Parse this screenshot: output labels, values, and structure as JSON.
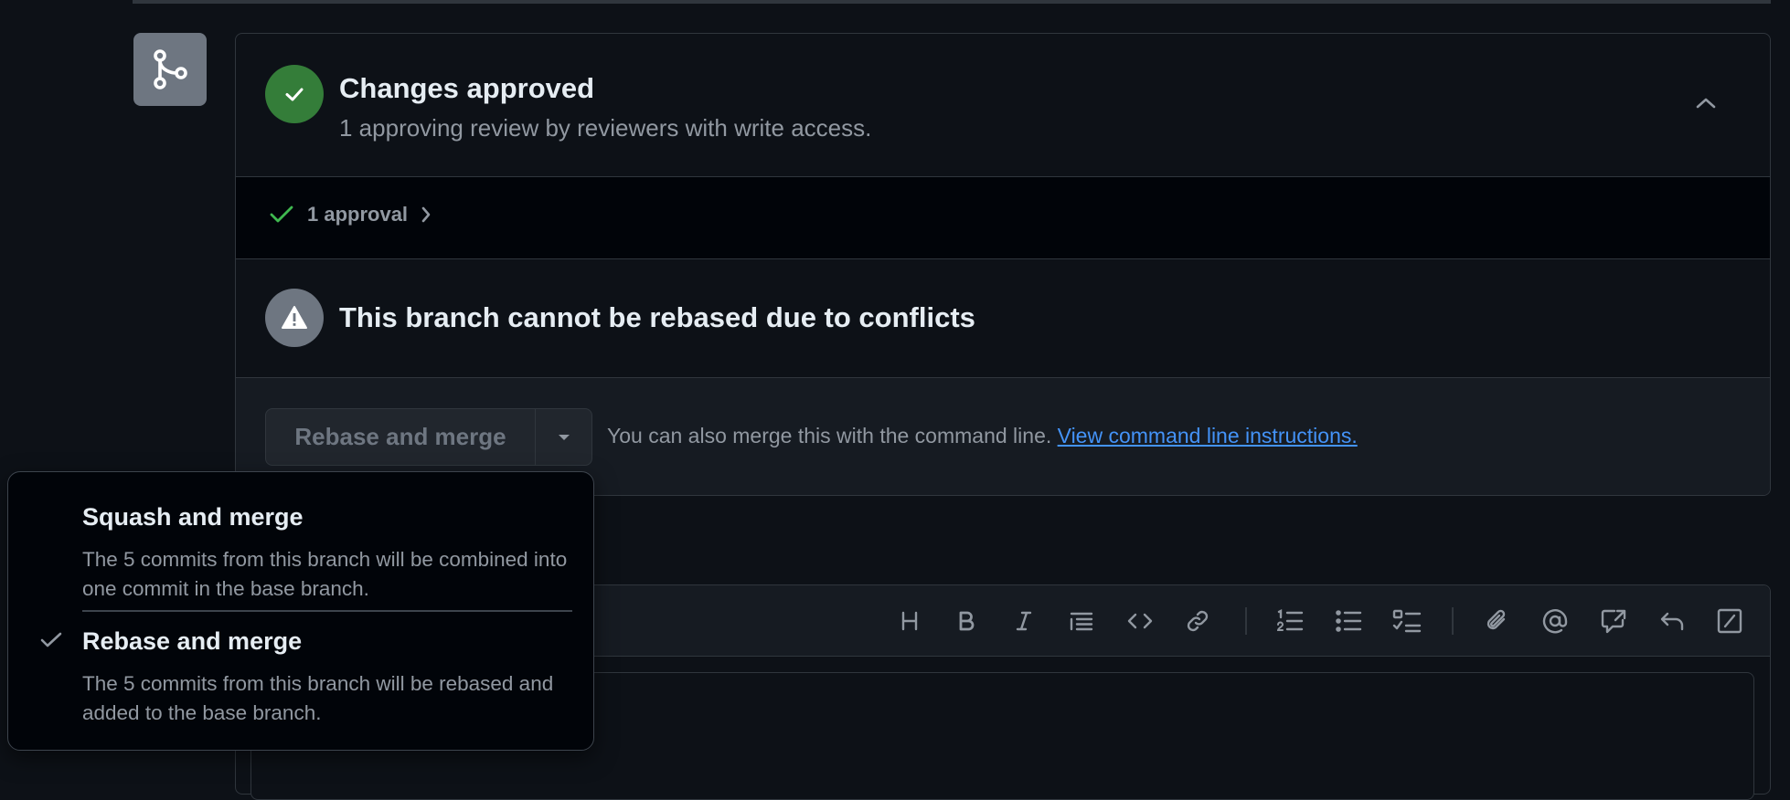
{
  "merge_panel": {
    "approval_section": {
      "title": "Changes approved",
      "subtitle": "1 approving review by reviewers with write access.",
      "approvals_summary": "1 approval"
    },
    "conflict_section": {
      "title": "This branch cannot be rebased due to conflicts"
    },
    "actions": {
      "merge_button_label": "Rebase and merge",
      "command_line_text": "You can also merge this with the command line.",
      "command_line_link": "View command line instructions."
    }
  },
  "merge_dropdown": {
    "options": [
      {
        "title": "Squash and merge",
        "description": "The 5 commits from this branch will be combined into one commit in the base branch.",
        "selected": false
      },
      {
        "title": "Rebase and merge",
        "description": "The 5 commits from this branch will be rebased and added to the base branch.",
        "selected": true
      }
    ]
  },
  "editor_toolbar": {
    "icons": [
      "heading-icon",
      "bold-icon",
      "italic-icon",
      "quote-icon",
      "code-icon",
      "link-icon",
      "numbered-list-icon",
      "bulleted-list-icon",
      "task-list-icon",
      "attach-icon",
      "mention-icon",
      "cross-reference-icon",
      "reply-icon",
      "slash-command-icon"
    ]
  },
  "colors": {
    "background": "#0d1117",
    "success": "#347d39",
    "neutral": "#6e7681",
    "link": "#4493f8",
    "muted_text": "#9198a1"
  }
}
